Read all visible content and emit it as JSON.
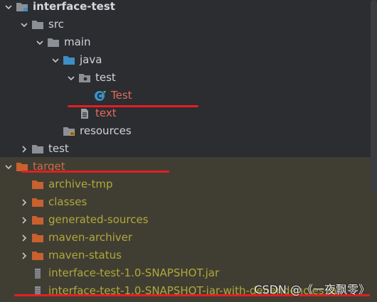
{
  "tree": {
    "rows": [
      {
        "label": "interface-test",
        "depth": 0,
        "arrow": "down",
        "icon": "module-folder-icon",
        "color": "#d4d7dc",
        "bold": true
      },
      {
        "label": "src",
        "depth": 1,
        "arrow": "down",
        "icon": "folder-icon",
        "color": "#cfd3da"
      },
      {
        "label": "main",
        "depth": 2,
        "arrow": "down",
        "icon": "folder-icon",
        "color": "#cfd3da"
      },
      {
        "label": "java",
        "depth": 3,
        "arrow": "down",
        "icon": "source-root-folder-icon",
        "color": "#cfd3da"
      },
      {
        "label": "test",
        "depth": 4,
        "arrow": "down",
        "icon": "package-folder-icon",
        "color": "#cfd3da"
      },
      {
        "label": "Test",
        "depth": 5,
        "arrow": "none",
        "icon": "java-class-icon",
        "color": "#e36b5f"
      },
      {
        "label": "text",
        "depth": 4,
        "arrow": "none",
        "icon": "text-file-icon",
        "color": "#e36b5f"
      },
      {
        "label": "resources",
        "depth": 3,
        "arrow": "none",
        "icon": "resources-folder-icon",
        "color": "#cfd3da"
      },
      {
        "label": "test",
        "depth": 1,
        "arrow": "right",
        "icon": "folder-icon",
        "color": "#cfd3da"
      },
      {
        "label": "target",
        "depth": 0,
        "arrow": "down",
        "icon": "excluded-folder-icon",
        "color": "#cf6b43"
      },
      {
        "label": "archive-tmp",
        "depth": 1,
        "arrow": "none",
        "icon": "excluded-folder-icon",
        "color": "#b0a83a"
      },
      {
        "label": "classes",
        "depth": 1,
        "arrow": "right",
        "icon": "excluded-folder-icon",
        "color": "#b0a83a"
      },
      {
        "label": "generated-sources",
        "depth": 1,
        "arrow": "right",
        "icon": "excluded-folder-icon",
        "color": "#b0a83a"
      },
      {
        "label": "maven-archiver",
        "depth": 1,
        "arrow": "right",
        "icon": "excluded-folder-icon",
        "color": "#b0a83a"
      },
      {
        "label": "maven-status",
        "depth": 1,
        "arrow": "right",
        "icon": "excluded-folder-icon",
        "color": "#b0a83a"
      },
      {
        "label": "interface-test-1.0-SNAPSHOT.jar",
        "depth": 1,
        "arrow": "none",
        "icon": "jar-file-icon",
        "color": "#b0a83a"
      },
      {
        "label": "interface-test-1.0-SNAPSHOT-jar-with-dependencies.jar",
        "depth": 1,
        "arrow": "none",
        "icon": "jar-file-icon",
        "color": "#b0a83a"
      }
    ]
  },
  "watermark": "CSDN @《一夜飘零》",
  "colors": {
    "background": "#2b2d30",
    "excluded_background": "#403e33",
    "highlight_underline": "#e41e23",
    "folder": "#8c9096",
    "excluded_folder": "#c8602f",
    "source_root": "#3d8fc6"
  }
}
